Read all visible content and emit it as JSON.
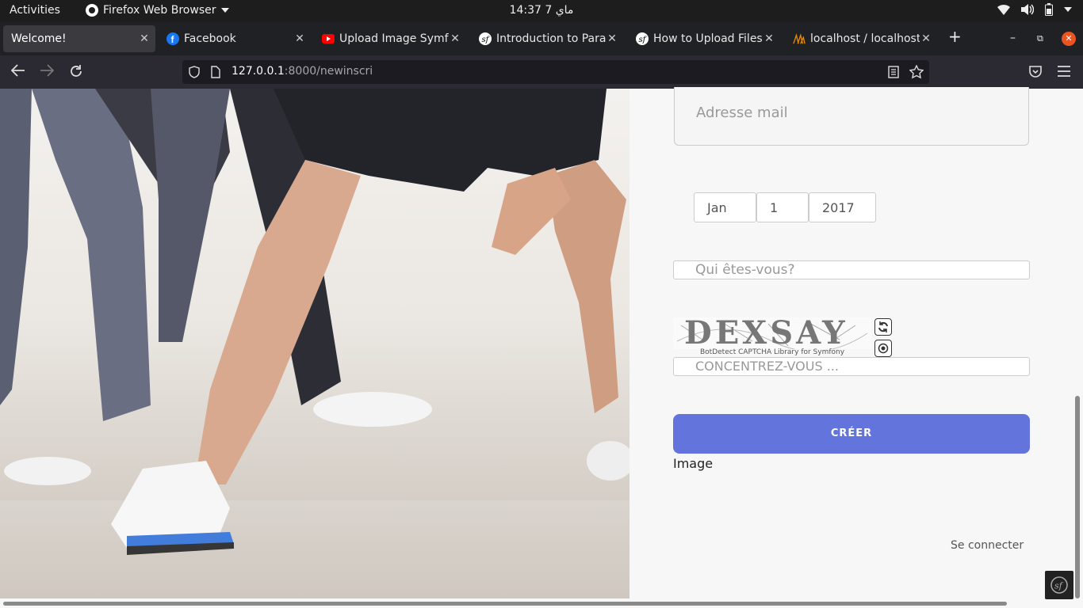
{
  "topbar": {
    "activities": "Activities",
    "app_name": "Firefox Web Browser",
    "clock": "14:37  7 ماي"
  },
  "tabs": [
    {
      "title": "Welcome!",
      "favicon": "none",
      "active": true
    },
    {
      "title": "Facebook",
      "favicon": "facebook-icon"
    },
    {
      "title": "Upload Image Symfony",
      "favicon": "youtube-icon"
    },
    {
      "title": "Introduction to Parameters",
      "favicon": "symfony-icon"
    },
    {
      "title": "How to Upload Files (",
      "favicon": "symfony-icon"
    },
    {
      "title": "localhost / localhost /",
      "favicon": "phpmyadmin-icon"
    }
  ],
  "nav": {
    "url_host": "127.0.0.1",
    "url_rest": ":8000/newinscri"
  },
  "form": {
    "email_placeholder": "Adresse mail",
    "birth_month": "Jan",
    "birth_day": "1",
    "birth_year": "2017",
    "who_placeholder": "Qui êtes-vous?",
    "captcha_code": "DEXSAY",
    "captcha_library": "BotDetect CAPTCHA Library for Symfony",
    "captcha_input_placeholder": "CONCENTREZ-VOUS ...",
    "submit_label": "CRÉER",
    "image_label": "Image",
    "login_link": "Se connecter"
  },
  "colors": {
    "accent": "#6474dd",
    "topbar": "#1d1d1d",
    "tabstrip": "#202124",
    "navbar": "#2b2a33"
  }
}
